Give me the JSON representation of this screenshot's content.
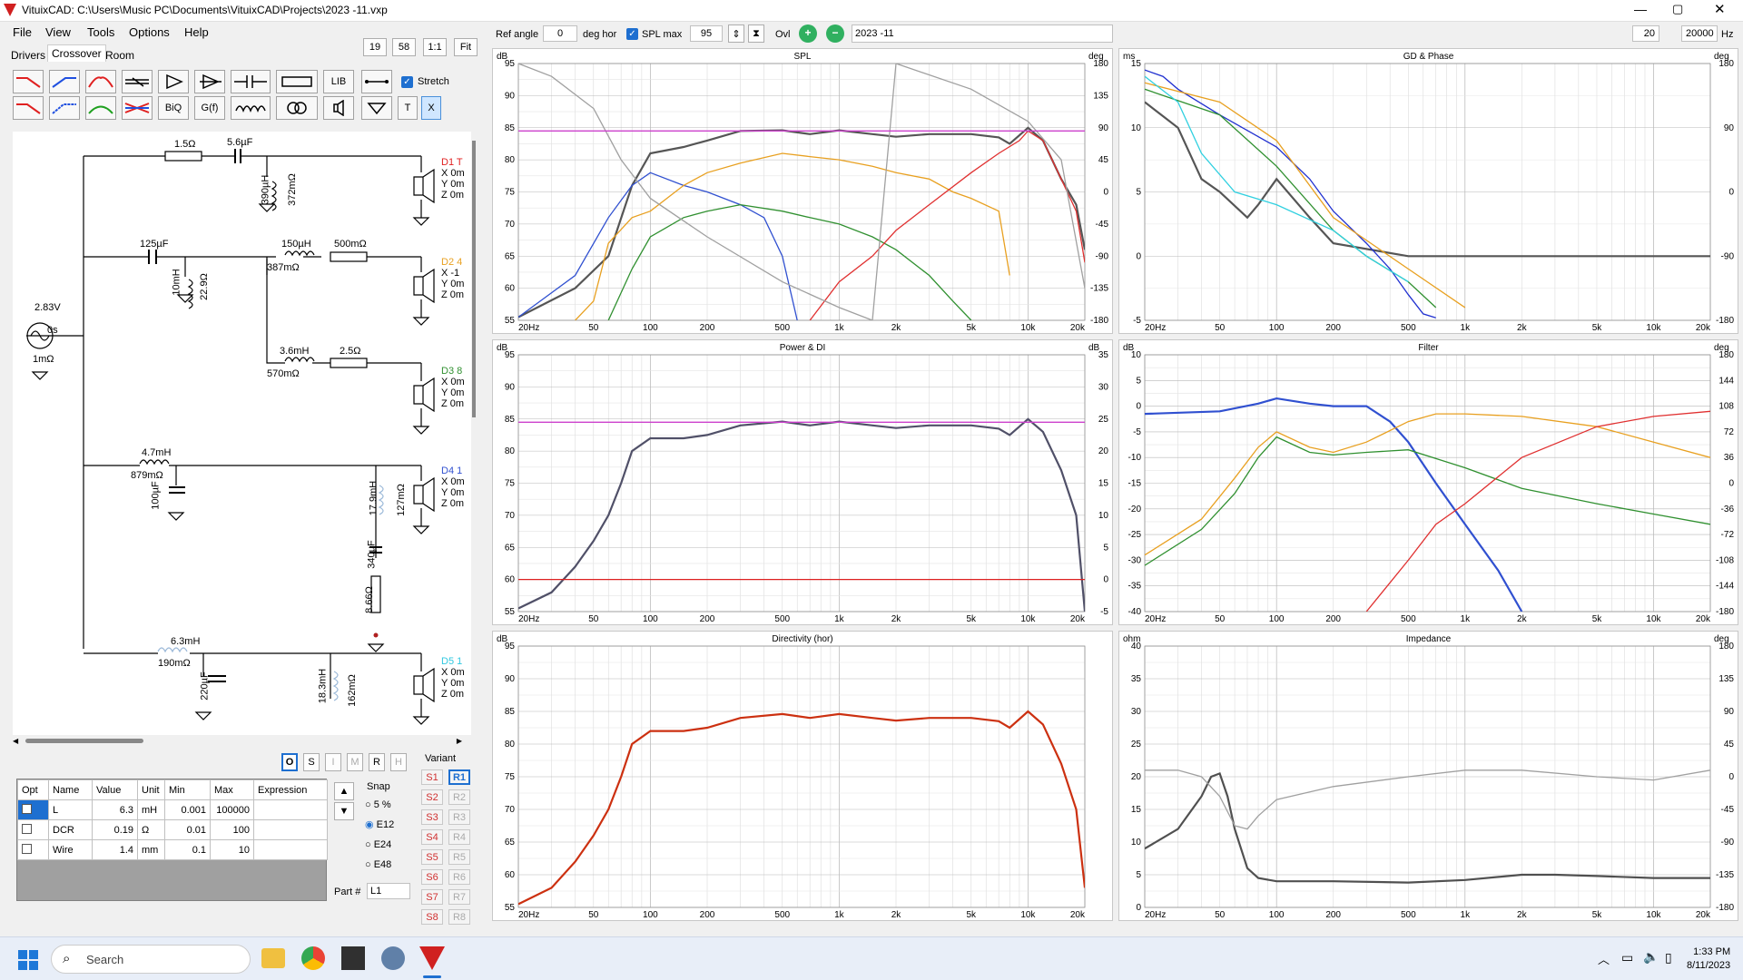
{
  "window": {
    "title": "VituixCAD: C:\\Users\\Music PC\\Documents\\VituixCAD\\Projects\\2023 -11.vxp"
  },
  "menu": [
    "File",
    "View",
    "Tools",
    "Options",
    "Help"
  ],
  "tabs": [
    "Drivers",
    "Crossover",
    "Room"
  ],
  "zoom_buttons": [
    "19",
    "58",
    "1:1",
    "Fit"
  ],
  "toolbar": {
    "lib": "LIB",
    "stretch_label": "Stretch",
    "biq": "BiQ",
    "gf": "G(f)",
    "t": "T",
    "x": "X"
  },
  "topbar": {
    "ref_angle_label": "Ref angle",
    "ref_angle_value": "0",
    "deg_hor": "deg hor",
    "spl_max_label": "SPL max",
    "spl_max_value": "95",
    "ovl_label": "Ovl",
    "project": "2023 -11",
    "fmin": "20",
    "fmax": "20000",
    "hz": "Hz"
  },
  "schematic": {
    "source": {
      "voltage": "2.83V",
      "delay": "0s",
      "resistance": "1mΩ"
    },
    "components": [
      "1.5Ω",
      "5.6µF",
      "390µH",
      "372mΩ",
      "125µF",
      "10mH",
      "22.9Ω",
      "150µH",
      "387mΩ",
      "500mΩ",
      "3.6mH",
      "570mΩ",
      "2.5Ω",
      "4.7mH",
      "879mΩ",
      "100µF",
      "17.9mH",
      "127mΩ",
      "340µF",
      "8.66Ω",
      "6.3mH",
      "190mΩ",
      "220µF",
      "18.3mH",
      "162mΩ"
    ],
    "drivers": [
      {
        "name": "D1 T",
        "lines": [
          "X 0m",
          "Y 0m",
          "Z 0m"
        ]
      },
      {
        "name": "D2 4",
        "lines": [
          "X -1",
          "Y 0m",
          "Z 0m"
        ]
      },
      {
        "name": "D3 8",
        "lines": [
          "X 0m",
          "Y 0m",
          "Z 0m"
        ]
      },
      {
        "name": "D4 1",
        "lines": [
          "X 0m",
          "Y 0m",
          "Z 0m"
        ]
      },
      {
        "name": "D5 1",
        "lines": [
          "X 0m",
          "Y 0m",
          "Z 0m"
        ]
      }
    ]
  },
  "mode_buttons": [
    "O",
    "S",
    "I",
    "M",
    "R",
    "H"
  ],
  "params": {
    "headers": [
      "Opt",
      "Name",
      "Value",
      "Unit",
      "Min",
      "Max",
      "Expression"
    ],
    "rows": [
      {
        "name": "L",
        "value": "6.3",
        "unit": "mH",
        "min": "0.001",
        "max": "100000"
      },
      {
        "name": "DCR",
        "value": "0.19",
        "unit": "Ω",
        "min": "0.01",
        "max": "100"
      },
      {
        "name": "Wire",
        "value": "1.4",
        "unit": "mm",
        "min": "0.1",
        "max": "10"
      }
    ],
    "snap_label": "Snap",
    "snap_options": [
      "5 %",
      "E12",
      "E24",
      "E48"
    ],
    "part_label": "Part #",
    "part_value": "L1"
  },
  "variant": {
    "label": "Variant",
    "s": [
      "S1",
      "S2",
      "S3",
      "S4",
      "S5",
      "S6",
      "S7",
      "S8"
    ],
    "r": [
      "R1",
      "R2",
      "R3",
      "R4",
      "R5",
      "R6",
      "R7",
      "R8"
    ]
  },
  "freq_ticks": [
    "20Hz",
    "50",
    "100",
    "200",
    "500",
    "1k",
    "2k",
    "5k",
    "10k",
    "20k"
  ],
  "chart_data": [
    {
      "type": "line",
      "title": "SPL",
      "ylabel": "dB",
      "y2label": "deg",
      "ylim": [
        55,
        95
      ],
      "y2lim": [
        -180,
        180
      ],
      "yticks": [
        "95",
        "90",
        "85",
        "80",
        "75",
        "70",
        "65",
        "60",
        "55"
      ],
      "y2ticks": [
        "180",
        "135",
        "90",
        "45",
        "0",
        "-45",
        "-90",
        "-135",
        "-180"
      ],
      "series": [
        {
          "color": "#555555",
          "x": [
            20,
            40,
            60,
            80,
            100,
            150,
            200,
            300,
            500,
            700,
            1000,
            1500,
            2000,
            3000,
            5000,
            7000,
            8000,
            10000,
            12000,
            15000,
            18000,
            20000
          ],
          "y": [
            55.5,
            60,
            65,
            76,
            81,
            82,
            83,
            84.5,
            84.6,
            84,
            84.6,
            84,
            83.6,
            84,
            84,
            83.5,
            82.5,
            85,
            83,
            77,
            73,
            66
          ]
        },
        {
          "color": "#3050d0",
          "x": [
            20,
            40,
            60,
            80,
            100,
            150,
            200,
            300,
            400,
            500,
            600
          ],
          "y": [
            55.5,
            62,
            71,
            76,
            78,
            76,
            75,
            73,
            71,
            65,
            55
          ]
        },
        {
          "color": "#e8a020",
          "x": [
            40,
            50,
            60,
            80,
            100,
            150,
            200,
            300,
            500,
            700,
            1000,
            1500,
            2000,
            3000,
            4000,
            5000,
            7000,
            8000
          ],
          "y": [
            55,
            58,
            67,
            71,
            72,
            76,
            78,
            79.5,
            81,
            80.5,
            80,
            79,
            78,
            77,
            75,
            74,
            72,
            62
          ]
        },
        {
          "color": "#309030",
          "x": [
            60,
            80,
            100,
            150,
            200,
            300,
            500,
            700,
            1000,
            1500,
            2000,
            3000,
            4000,
            5000
          ],
          "y": [
            55,
            63,
            68,
            71,
            72,
            73,
            72,
            71,
            70,
            68,
            66,
            62,
            58,
            55
          ]
        },
        {
          "color": "#e03030",
          "x": [
            700,
            1000,
            1500,
            2000,
            3000,
            5000,
            7000,
            9000,
            10000,
            12000,
            15000,
            18000,
            20000
          ],
          "y": [
            55,
            61,
            65,
            69,
            73,
            78,
            81,
            83,
            84.5,
            83,
            77,
            72,
            64
          ]
        },
        {
          "color": "#a0a0a0",
          "x": [
            20,
            30,
            50,
            70,
            100,
            200,
            500,
            1000,
            1500,
            2000,
            5000,
            10000,
            15000,
            20000
          ],
          "y": [
            95,
            93,
            88,
            80,
            74,
            68,
            61,
            57,
            55,
            95,
            91,
            86,
            80,
            60
          ]
        },
        {
          "color": "#cc40cc",
          "x": [
            20,
            20000
          ],
          "y": [
            84.5,
            84.5
          ]
        }
      ]
    },
    {
      "type": "line",
      "title": "GD & Phase",
      "ylabel": "ms",
      "y2label": "deg",
      "ylim": [
        -5,
        15
      ],
      "y2lim": [
        -180,
        180
      ],
      "yticks": [
        "15",
        "10",
        "5",
        "0",
        "-5"
      ],
      "y2ticks": [
        "180",
        "90",
        "0",
        "-90",
        "-180"
      ],
      "series": [
        {
          "color": "#555555",
          "x": [
            20,
            30,
            40,
            50,
            70,
            80,
            100,
            150,
            200,
            500,
            1000,
            2000,
            5000,
            10000,
            20000
          ],
          "y": [
            12,
            10,
            6,
            5,
            3,
            4,
            6,
            3,
            1,
            0,
            0,
            0,
            0,
            0,
            0
          ]
        },
        {
          "color": "#2030d0",
          "x": [
            20,
            25,
            30,
            50,
            100,
            150,
            200,
            300,
            400,
            500,
            600,
            700
          ],
          "y": [
            14.5,
            14,
            13,
            11,
            8.5,
            6,
            3.5,
            1,
            -1,
            -3,
            -4.5,
            -4.8
          ]
        },
        {
          "color": "#309030",
          "x": [
            20,
            50,
            100,
            200,
            300,
            500,
            700
          ],
          "y": [
            13,
            11,
            7,
            2,
            0,
            -2,
            -4
          ]
        },
        {
          "color": "#e8a020",
          "x": [
            20,
            50,
            100,
            200,
            500,
            1000
          ],
          "y": [
            13.5,
            12,
            9,
            3,
            -1,
            -4
          ]
        },
        {
          "color": "#30d0e0",
          "x": [
            20,
            30,
            40,
            60,
            100,
            200,
            300,
            500
          ],
          "y": [
            14,
            12,
            8,
            5,
            4,
            2,
            0,
            -2
          ]
        }
      ]
    },
    {
      "type": "line",
      "title": "Power & DI",
      "ylabel": "dB",
      "y2label": "dB",
      "ylim": [
        55,
        95
      ],
      "y2lim": [
        -5,
        35
      ],
      "yticks": [
        "95",
        "90",
        "85",
        "80",
        "75",
        "70",
        "65",
        "60",
        "55"
      ],
      "y2ticks": [
        "35",
        "30",
        "25",
        "20",
        "15",
        "10",
        "5",
        "0",
        "-5"
      ],
      "series": [
        {
          "color": "#505068",
          "x": [
            20,
            30,
            40,
            50,
            60,
            70,
            80,
            100,
            150,
            200,
            300,
            500,
            700,
            1000,
            1500,
            2000,
            3000,
            5000,
            7000,
            8000,
            10000,
            12000,
            15000,
            18000,
            20000
          ],
          "y": [
            55.5,
            58,
            62,
            66,
            70,
            75,
            80,
            82,
            82,
            82.5,
            84,
            84.6,
            84,
            84.6,
            84,
            83.6,
            84,
            84,
            83.5,
            82.5,
            85,
            83,
            77,
            70,
            55
          ]
        },
        {
          "color": "#dd2020",
          "x": [
            20,
            20000
          ],
          "y": [
            60,
            60
          ]
        },
        {
          "color": "#cc40cc",
          "x": [
            20,
            20000
          ],
          "y": [
            84.5,
            84.5
          ]
        }
      ]
    },
    {
      "type": "line",
      "title": "Filter",
      "ylabel": "dB",
      "y2label": "deg",
      "ylim": [
        -40,
        10
      ],
      "y2lim": [
        -180,
        180
      ],
      "yticks": [
        "10",
        "5",
        "0",
        "-5",
        "-10",
        "-15",
        "-20",
        "-25",
        "-30",
        "-35",
        "-40"
      ],
      "y2ticks": [
        "180",
        "144",
        "108",
        "72",
        "36",
        "0",
        "-36",
        "-72",
        "-108",
        "-144",
        "-180"
      ],
      "series": [
        {
          "color": "#3050d0",
          "x": [
            20,
            50,
            80,
            100,
            150,
            200,
            300,
            400,
            500,
            700,
            1000,
            1500,
            2000
          ],
          "y": [
            -1.5,
            -1,
            0.5,
            1.5,
            0.5,
            0,
            0,
            -3,
            -7,
            -15,
            -23,
            -32,
            -40
          ]
        },
        {
          "color": "#e8a020",
          "x": [
            20,
            40,
            60,
            80,
            100,
            150,
            200,
            300,
            500,
            700,
            1000,
            2000,
            5000,
            10000,
            20000
          ],
          "y": [
            -29,
            -22,
            -14,
            -8,
            -5,
            -8,
            -9,
            -7,
            -3,
            -1.5,
            -1.5,
            -2,
            -4,
            -7,
            -10
          ]
        },
        {
          "color": "#309030",
          "x": [
            20,
            40,
            60,
            80,
            100,
            150,
            200,
            300,
            500,
            1000,
            2000,
            5000,
            10000,
            20000
          ],
          "y": [
            -31,
            -24,
            -17,
            -10,
            -6,
            -9,
            -9.5,
            -9,
            -8.5,
            -12,
            -16,
            -19,
            -21,
            -23
          ]
        },
        {
          "color": "#e03030",
          "x": [
            300,
            500,
            700,
            1000,
            2000,
            5000,
            10000,
            20000
          ],
          "y": [
            -40,
            -30,
            -23,
            -19,
            -10,
            -4,
            -2,
            -1
          ]
        }
      ]
    },
    {
      "type": "line",
      "title": "Directivity (hor)",
      "ylabel": "dB",
      "ylim": [
        55,
        95
      ],
      "yticks": [
        "95",
        "90",
        "85",
        "80",
        "75",
        "70",
        "65",
        "60",
        "55"
      ],
      "series": [
        {
          "color": "#cc3010",
          "x": [
            20,
            30,
            40,
            50,
            60,
            70,
            80,
            100,
            150,
            200,
            300,
            500,
            700,
            1000,
            1500,
            2000,
            3000,
            5000,
            7000,
            8000,
            10000,
            12000,
            15000,
            18000,
            20000
          ],
          "y": [
            55.5,
            58,
            62,
            66,
            70,
            75,
            80,
            82,
            82,
            82.5,
            84,
            84.6,
            84,
            84.6,
            84,
            83.6,
            84,
            84,
            83.5,
            82.5,
            85,
            83,
            77,
            70,
            58
          ]
        }
      ]
    },
    {
      "type": "line",
      "title": "Impedance",
      "ylabel": "ohm",
      "y2label": "deg",
      "ylim": [
        0,
        40
      ],
      "y2lim": [
        -180,
        180
      ],
      "yticks": [
        "40",
        "35",
        "30",
        "25",
        "20",
        "15",
        "10",
        "5",
        "0"
      ],
      "y2ticks": [
        "180",
        "135",
        "90",
        "45",
        "0",
        "-45",
        "-90",
        "-135",
        "-180"
      ],
      "series": [
        {
          "color": "#505050",
          "x": [
            20,
            30,
            40,
            45,
            50,
            55,
            60,
            70,
            80,
            100,
            200,
            500,
            1000,
            2000,
            3000,
            5000,
            10000,
            20000
          ],
          "y": [
            9,
            12,
            17,
            20,
            20.5,
            17,
            12,
            6,
            4.5,
            4,
            4,
            3.8,
            4.2,
            5,
            5,
            4.8,
            4.5,
            4.5
          ]
        },
        {
          "color": "#a0a0a0",
          "x": [
            20,
            30,
            40,
            50,
            60,
            70,
            80,
            100,
            200,
            500,
            1000,
            2000,
            5000,
            10000,
            20000
          ],
          "y": [
            21,
            21,
            20,
            17,
            12.5,
            12,
            14,
            16.5,
            18.5,
            20,
            21,
            21,
            20,
            19.5,
            21
          ]
        }
      ]
    }
  ],
  "taskbar": {
    "search": "Search",
    "time": "1:33 PM",
    "date": "8/11/2023"
  }
}
